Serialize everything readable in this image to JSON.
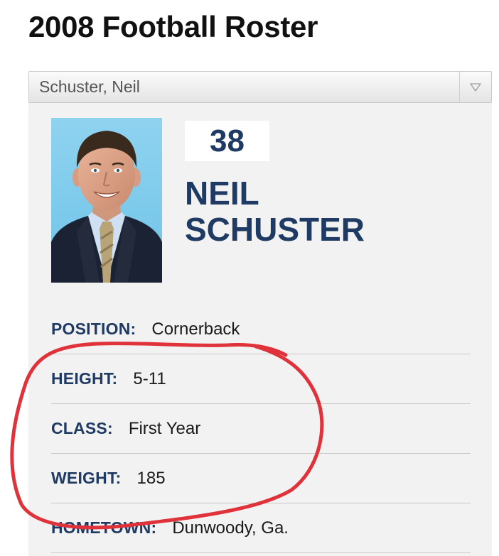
{
  "page_title": "2008 Football Roster",
  "player_select": {
    "selected": "Schuster, Neil",
    "arrow_icon": "triangle-down-icon"
  },
  "player": {
    "number": "38",
    "first_name": "NEIL",
    "last_name": "SCHUSTER"
  },
  "details": [
    {
      "label": "POSITION:",
      "value": "Cornerback"
    },
    {
      "label": "HEIGHT:",
      "value": "5-11"
    },
    {
      "label": "CLASS:",
      "value": "First Year"
    },
    {
      "label": "WEIGHT:",
      "value": "185"
    },
    {
      "label": "HOMETOWN:",
      "value": "Dunwoody, Ga."
    }
  ],
  "colors": {
    "accent": "#1f3a63",
    "annotation": "#e0323a",
    "card_background": "#f2f2f2"
  }
}
